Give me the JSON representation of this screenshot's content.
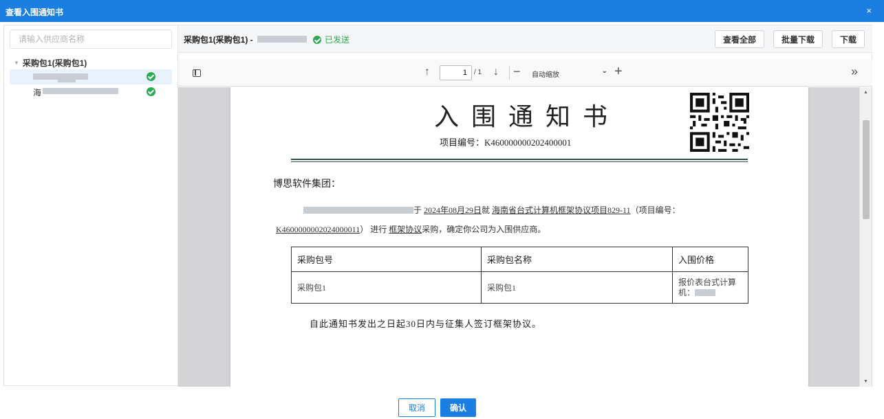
{
  "window": {
    "title": "查看入围通知书",
    "close_label": "×"
  },
  "sidebar": {
    "search_placeholder": "请输入供应商名称",
    "group_label": "采购包1(采购包1)",
    "group_caret": "▼",
    "items": [
      {
        "status": "sent",
        "active": true
      },
      {
        "prefix": "海",
        "status": "sent",
        "active": false
      }
    ]
  },
  "header": {
    "package_label": "采购包1(采购包1) - ",
    "status_text": "已发送",
    "buttons": {
      "view_all": "查看全部",
      "batch_download": "批量下载",
      "download": "下载"
    }
  },
  "pdf_toolbar": {
    "prev_icon": "↑",
    "next_icon": "↓",
    "page_value": "1",
    "page_count": "/ 1",
    "zoom_out": "−",
    "zoom_in": "+",
    "zoom_value": "自动缩放",
    "zoom_chevron": "⌄",
    "more_icon": "»"
  },
  "document": {
    "title": "入围通知书",
    "project_no_label": "项目编号：K460000000202400001",
    "salutation": "博思软件集团：",
    "body_part1": "于",
    "body_date": "2024年08月29日",
    "body_part2": "就",
    "body_project": "海南省台式计算机框架协议项目829-11",
    "body_part3": "（项目编号：",
    "body_project_no": "K4600000002024000011",
    "body_part4": "） 进行",
    "body_method": "框架协议",
    "body_part5": "采购，确定你公司为入围供应商。",
    "table": {
      "headers": [
        "采购包号",
        "采购包名称",
        "入围价格"
      ],
      "rows": [
        [
          "采购包1",
          "采购包1",
          "报价表台式计算机："
        ]
      ]
    },
    "closing": "自此通知书发出之日起30日内与征集人签订框架协议。"
  },
  "footer": {
    "cancel": "取消",
    "confirm": "确认"
  },
  "colors": {
    "primary": "#1a7fe0",
    "success": "#2aaa52",
    "viewer_bg": "#d4d4d7"
  }
}
